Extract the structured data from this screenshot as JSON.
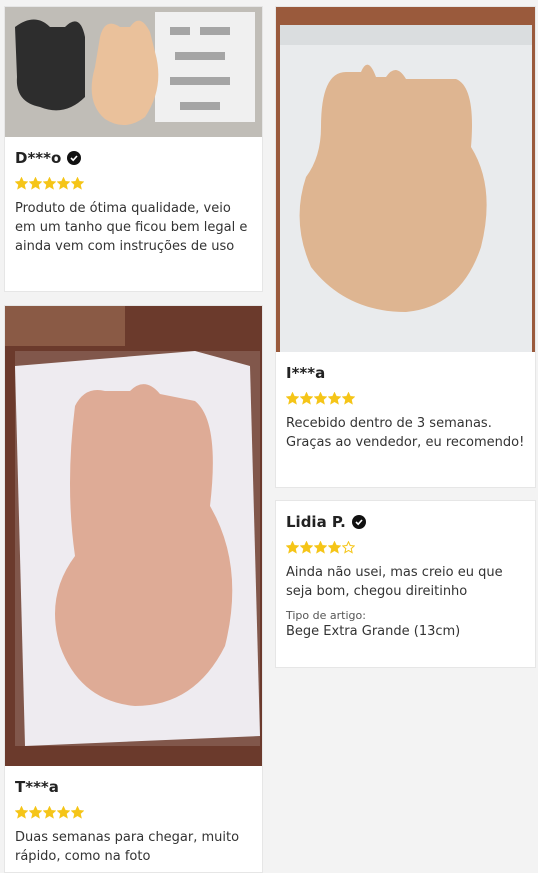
{
  "reviews": [
    {
      "name": "D***o",
      "verified": true,
      "rating": 5,
      "text": "Produto de ótima qualidade, veio em um tanho que ficou bem legal e ainda vem com instruções de uso"
    },
    {
      "name": "I***a",
      "verified": false,
      "rating": 5,
      "text": "Recebido dentro de 3 semanas. Graças ao vendedor, eu recomendo!"
    },
    {
      "name": "Lidia P.",
      "verified": true,
      "rating": 4,
      "text": "Ainda não usei, mas creio eu que seja bom, chegou direitinho",
      "item_type_label": "Tipo de artigo:",
      "item_type_value": "Bege Extra Grande (13cm)"
    },
    {
      "name": "T***a",
      "verified": false,
      "rating": 5,
      "text": "Duas semanas para chegar, muito rápido, como na foto"
    }
  ],
  "colors": {
    "star": "#f5c518",
    "star_empty_stroke": "#f5c518",
    "verified_bg": "#111111"
  }
}
